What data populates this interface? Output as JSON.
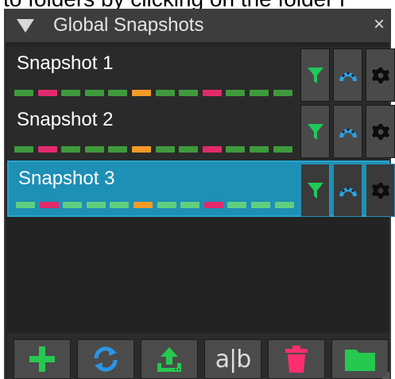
{
  "background_caption": "to folders by clicking on the folder i",
  "panel": {
    "title": "Global Snapshots",
    "collapse_icon": "collapse-triangle-icon",
    "close_glyph": "×"
  },
  "colors": {
    "dash_green": "#3f9a3c",
    "dash_green_selected": "#5fcf7f",
    "dash_pink": "#e22a6b",
    "dash_orange": "#f39a27",
    "selected_row": "#1e8fb5",
    "filter_icon": "#1ec95a",
    "morph_icon": "#2aa3e8",
    "add_icon": "#27c84f",
    "sync_icon": "#2a96e6",
    "export_icon": "#27c84f",
    "delete_icon": "#ff2e6f",
    "folder_icon": "#27c84f"
  },
  "snapshots": [
    {
      "name": "Snapshot 1",
      "selected": false,
      "dashes": [
        "green",
        "pink",
        "green",
        "green",
        "green",
        "orange",
        "green",
        "green",
        "pink",
        "green",
        "green",
        "green"
      ],
      "buttons": [
        "filter-icon",
        "morph-icon",
        "gear-icon"
      ]
    },
    {
      "name": "Snapshot 2",
      "selected": false,
      "dashes": [
        "green",
        "pink",
        "green",
        "green",
        "green",
        "orange",
        "green",
        "green",
        "pink",
        "green",
        "green",
        "green"
      ],
      "buttons": [
        "filter-icon",
        "morph-icon",
        "gear-icon"
      ]
    },
    {
      "name": "Snapshot 3",
      "selected": true,
      "dashes": [
        "green",
        "pink",
        "green",
        "green",
        "green",
        "orange",
        "green",
        "green",
        "pink",
        "green",
        "green",
        "green"
      ],
      "buttons": [
        "filter-icon",
        "morph-icon",
        "gear-icon"
      ]
    }
  ],
  "toolbar": {
    "buttons": [
      "add-icon",
      "sync-icon",
      "export-icon",
      "rename-ab-icon",
      "trash-icon",
      "folder-icon"
    ],
    "rename_text": "a|b"
  }
}
